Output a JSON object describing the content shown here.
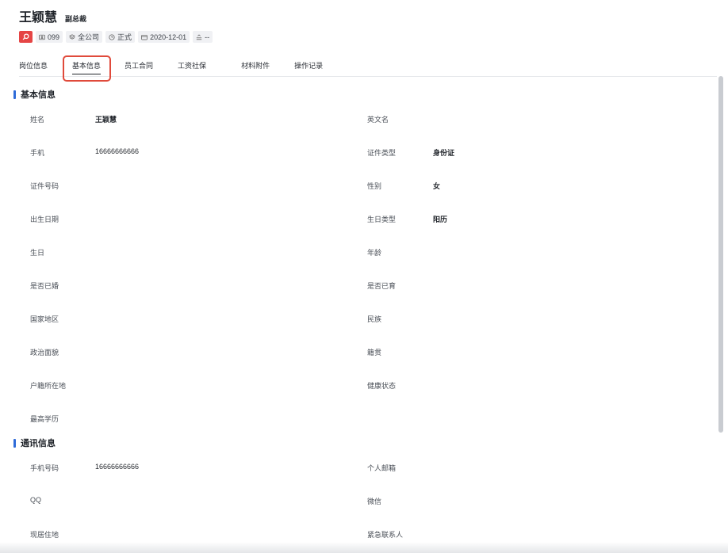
{
  "header": {
    "name": "王颖慧",
    "title": "副总裁",
    "tags": {
      "id": "099",
      "scope": "全公司",
      "status": "正式",
      "date": "2020-12-01",
      "extra": "--"
    }
  },
  "tabs": [
    "岗位信息",
    "基本信息",
    "员工合同",
    "工资社保",
    "材料附件",
    "操作记录"
  ],
  "active_tab": "基本信息",
  "basic": {
    "title": "基本信息",
    "name_label": "姓名",
    "name_value": "王颖慧",
    "english_label": "英文名",
    "phone_label": "手机",
    "phone_value": "16666666666",
    "idtype_label": "证件类型",
    "idtype_value": "身份证",
    "idno_label": "证件号码",
    "gender_label": "性别",
    "gender_value": "女",
    "birthdate_label": "出生日期",
    "birthtype_label": "生日类型",
    "birthtype_value": "阳历",
    "birthday_label": "生日",
    "age_label": "年龄",
    "married_label": "是否已婚",
    "children_label": "是否已育",
    "country_label": "国家地区",
    "ethnic_label": "民族",
    "political_label": "政治面貌",
    "native_label": "籍贯",
    "hukou_label": "户籍所在地",
    "health_label": "健康状态",
    "education_label": "最高学历"
  },
  "contact": {
    "title": "通讯信息",
    "mobile_label": "手机号码",
    "mobile_value": "16666666666",
    "email_label": "个人邮箱",
    "qq_label": "QQ",
    "wechat_label": "微信",
    "address_label": "现居住地",
    "emergency_label": "紧急联系人"
  }
}
